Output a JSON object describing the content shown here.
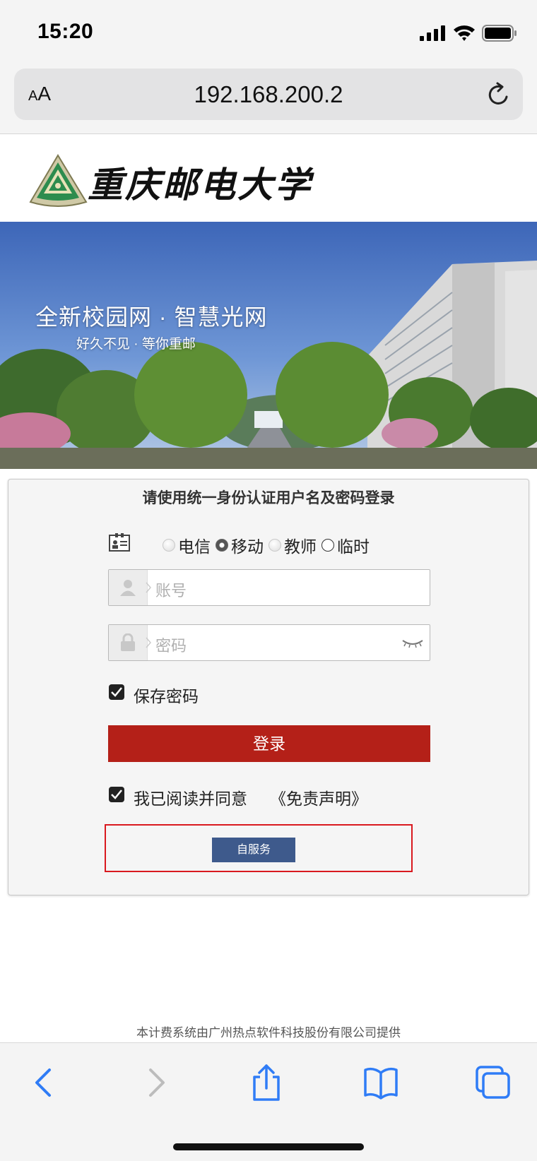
{
  "status": {
    "time": "15:20"
  },
  "browser": {
    "text_size_label_small": "A",
    "text_size_label_large": "A",
    "url": "192.168.200.2"
  },
  "header": {
    "logo_text": "重庆邮电大学"
  },
  "banner": {
    "title": "全新校园网 · 智慧光网",
    "subtitle": "好久不见 · 等你重邮"
  },
  "login": {
    "title": "请使用统一身份认证用户名及密码登录",
    "carriers": [
      {
        "label": "电信",
        "selected": false
      },
      {
        "label": "移动",
        "selected": true
      },
      {
        "label": "教师",
        "selected": false
      },
      {
        "label": "临时",
        "selected": false
      }
    ],
    "account_placeholder": "账号",
    "password_placeholder": "密码",
    "save_password_label": "保存密码",
    "save_password_checked": true,
    "login_button": "登录",
    "agree_label": "我已阅读并同意",
    "agree_checked": true,
    "disclaimer_link": "《免责声明》",
    "self_service_button": "自服务"
  },
  "footer": {
    "text": "本计费系统由广州热点软件科技股份有限公司提供"
  },
  "toolbar": {
    "icons": [
      "back-icon",
      "forward-icon",
      "share-icon",
      "bookmarks-icon",
      "tabs-icon"
    ]
  },
  "colors": {
    "login_button": "#b42018",
    "self_service": "#3e5a8c",
    "highlight_box": "#d9191f",
    "link_blue": "#2f7cf6"
  }
}
